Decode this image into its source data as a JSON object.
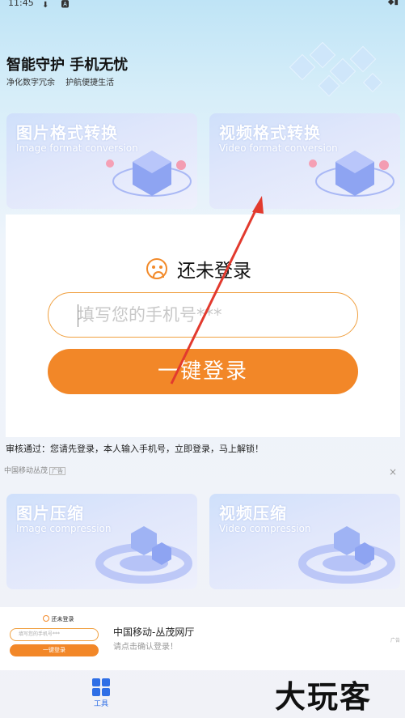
{
  "status_bar": {
    "time": "11:45",
    "left_icons": "⬇ 🅰"
  },
  "hero": {
    "title": "智能守护 手机无忧",
    "subtitle": "净化数字冗余 护航便捷生活"
  },
  "cards": [
    {
      "title": "图片格式转换",
      "subtitle": "Image format conversion"
    },
    {
      "title": "视频格式转换",
      "subtitle": "Video format conversion"
    },
    {
      "title": "图片压缩",
      "subtitle": "Image compression"
    },
    {
      "title": "视频压缩",
      "subtitle": "Video compression"
    }
  ],
  "login": {
    "title": "还未登录",
    "phone_placeholder": "填写您的手机号***",
    "button_label": "一键登录"
  },
  "audit_text": "审核通过：您请先登录，本人输入手机号，立即登录，马上解锁！",
  "ad": {
    "label": "中国移动丛茂",
    "tag": "广告",
    "close": "×",
    "mini_title": "还未登录",
    "mini_placeholder": "填写您的手机号***",
    "mini_button": "一键登录",
    "line1": "中国移动-丛茂网厅",
    "line2": "请点击确认登录！",
    "corner_tag": "广告"
  },
  "tabbar": {
    "tools_label": "工具"
  },
  "watermark": "大玩客",
  "colors": {
    "accent": "#f28728",
    "tab_active": "#2f6fe6"
  }
}
